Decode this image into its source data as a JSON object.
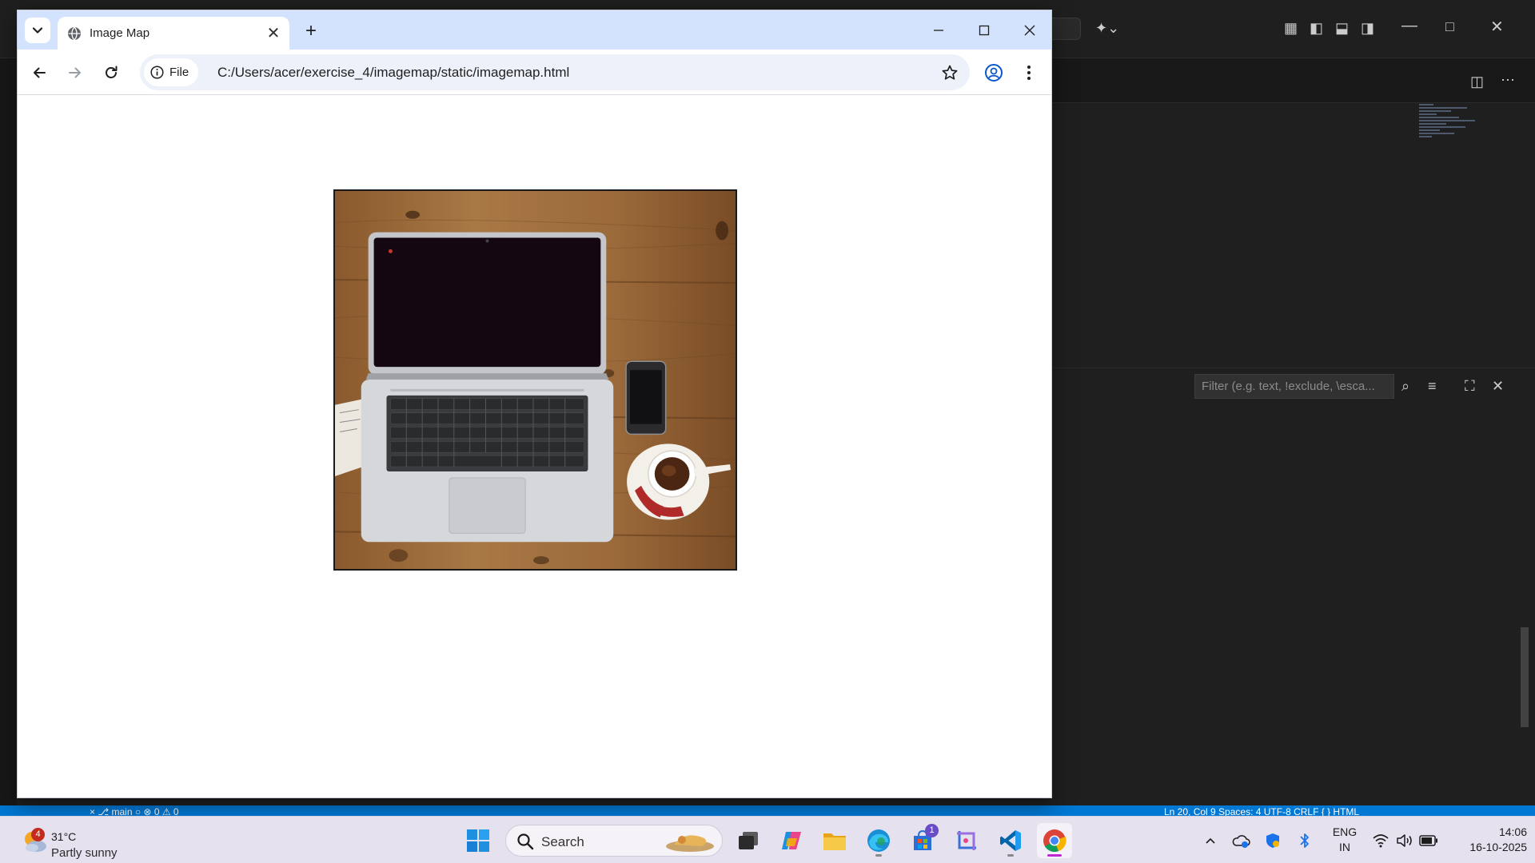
{
  "browser": {
    "tab_title": "Image Map",
    "address_chip": "File",
    "url": "C:/Users/acer/exercise_4/imagemap/static/imagemap.html"
  },
  "vscode": {
    "filter_placeholder": "Filter (e.g. text, !exclude, \\esca...",
    "status_left": "×  ⎇ main ○   ⊗ 0 ⚠ 0",
    "status_right": "Ln 20, Col 9   Spaces: 4   UTF-8   CRLF   { } HTML"
  },
  "taskbar": {
    "weather_badge": "4",
    "temperature": "31°C",
    "weather": "Partly sunny",
    "search_label": "Search",
    "store_badge": "1",
    "language": "ENG",
    "region": "IN",
    "time": "14:06",
    "date": "16-10-2025"
  },
  "colors": {
    "chrome_tabstrip": "#d3e3fd",
    "omnibox": "#edf2fa",
    "vscode_status": "#0078d4",
    "taskbar": "#e6e1ef"
  }
}
